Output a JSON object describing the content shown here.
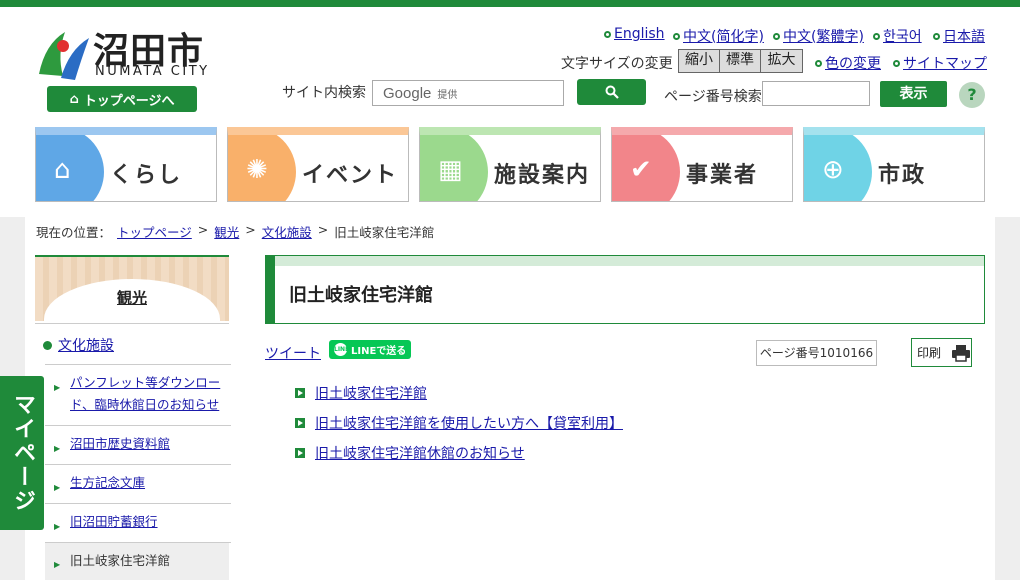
{
  "header": {
    "logo_title": "沼田市",
    "logo_sub": "NUMATA CITY",
    "top_button": "トップページへ",
    "languages": [
      "English",
      "中文(简化字)",
      "中文(繁體字)",
      "한국어",
      "日本語"
    ],
    "text_size_label": "文字サイズの変更",
    "text_sizes": [
      "縮小",
      "標準",
      "拡大"
    ],
    "color_change": "色の変更",
    "sitemap": "サイトマップ",
    "site_search_label": "サイト内検索",
    "search_google": "Google",
    "search_provided": "提供",
    "page_number_label": "ページ番号検索",
    "show_button": "表示",
    "help": "?"
  },
  "nav": [
    {
      "label": "くらし",
      "color": "#5fa7e6"
    },
    {
      "label": "イベント",
      "color": "#f9b06a"
    },
    {
      "label": "施設案内",
      "color": "#9bd98d"
    },
    {
      "label": "事業者",
      "color": "#f2858a"
    },
    {
      "label": "市政",
      "color": "#6fd3e6"
    }
  ],
  "breadcrumb": {
    "prefix": "現在の位置：",
    "items": [
      "トップページ",
      "観光",
      "文化施設"
    ],
    "current": "旧土岐家住宅洋館",
    "sep": ">"
  },
  "sidebar": {
    "heading": "観光",
    "category": "文化施設",
    "items": [
      "パンフレット等ダウンロード、臨時休館日のお知らせ",
      "沼田市歴史資料館",
      "生方記念文庫",
      "旧沼田貯蓄銀行",
      "旧土岐家住宅洋館"
    ]
  },
  "mypage": "マイページ",
  "main": {
    "title": "旧土岐家住宅洋館",
    "tweet": "ツイート",
    "line": "LINEで送る",
    "page_number": "ページ番号1010166",
    "print": "印刷",
    "links": [
      "旧土岐家住宅洋館",
      "旧土岐家住宅洋館を使用したい方へ【貸室利用】",
      "旧土岐家住宅洋館休館のお知らせ"
    ]
  }
}
